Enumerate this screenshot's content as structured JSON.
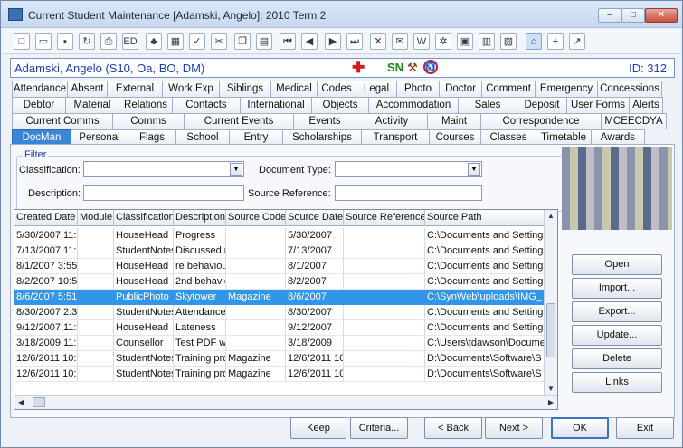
{
  "window": {
    "title": "Current Student Maintenance  [Adamski, Angelo]:  2010 Term 2",
    "min": "–",
    "max": "□",
    "close": "✕"
  },
  "toolbar": {
    "icons": [
      {
        "name": "new-icon",
        "g": "□"
      },
      {
        "name": "open-folder-icon",
        "g": "▭"
      },
      {
        "name": "save-icon",
        "g": "▪"
      },
      {
        "name": "refresh-icon",
        "g": "↻"
      },
      {
        "name": "print-icon",
        "g": "⎙"
      },
      {
        "name": "edit-icon",
        "g": "ED"
      },
      {
        "name": "tree-icon",
        "g": "♣"
      },
      {
        "name": "calculator-icon",
        "g": "▦"
      },
      {
        "name": "spellcheck-icon",
        "g": "✓"
      },
      {
        "name": "cut-icon",
        "g": "✂"
      },
      {
        "name": "copy-icon",
        "g": "❐"
      },
      {
        "name": "paste-icon",
        "g": "▤"
      },
      {
        "name": "first-record-icon",
        "g": "⏮"
      },
      {
        "name": "previous-record-icon",
        "g": "◀"
      },
      {
        "name": "next-record-icon",
        "g": "▶"
      },
      {
        "name": "last-record-icon",
        "g": "⏭"
      },
      {
        "name": "delete-icon",
        "g": "✕"
      },
      {
        "name": "mail-icon",
        "g": "✉"
      },
      {
        "name": "word-icon",
        "g": "W"
      },
      {
        "name": "network-icon",
        "g": "✲"
      },
      {
        "name": "clipboard-icon",
        "g": "▣"
      },
      {
        "name": "barcode-icon",
        "g": "▥"
      },
      {
        "name": "certificate-icon",
        "g": "▧"
      },
      {
        "name": "tag-icon",
        "g": "⌂"
      },
      {
        "name": "add-document-icon",
        "g": "+"
      },
      {
        "name": "arrow-up-right-icon",
        "g": "↗"
      }
    ]
  },
  "student": {
    "name": "Adamski, Angelo (S10, Oa, BO, DM)",
    "sn_label": "SN",
    "id_label": "ID: 312"
  },
  "tabs": {
    "row1": [
      "Attendance",
      "Absent",
      "External",
      "Work Exp",
      "Siblings",
      "Medical",
      "Codes",
      "Legal",
      "Photo",
      "Doctor",
      "Comment",
      "Emergency",
      "Concessions"
    ],
    "row2": [
      "Debtor",
      "Material",
      "Relations",
      "Contacts",
      "International",
      "Objects",
      "Accommodation",
      "Sales",
      "Deposit",
      "User Forms",
      "Alerts"
    ],
    "row3": [
      "Current Comms",
      "Comms",
      "Current Events",
      "Events",
      "Activity",
      "Maint",
      "Correspondence",
      "MCEECDYA"
    ],
    "row4": [
      "DocMan",
      "Personal",
      "Flags",
      "School",
      "Entry",
      "Scholarships",
      "Transport",
      "Courses",
      "Classes",
      "Timetable",
      "Awards"
    ],
    "active": "DocMan"
  },
  "filter": {
    "legend": "Filter",
    "classification_label": "Classification:",
    "classification_value": "",
    "document_type_label": "Document Type:",
    "document_type_value": "",
    "description_label": "Description:",
    "description_value": "",
    "source_reference_label": "Source Reference:",
    "source_reference_value": ""
  },
  "grid": {
    "columns": [
      "Created Date",
      "Module",
      "Classification",
      "Description",
      "Source Code",
      "Source Date",
      "Source Reference",
      "Source Path"
    ],
    "rows": [
      [
        "5/30/2007 11:",
        "",
        "HouseHead",
        "Progress",
        "",
        "5/30/2007",
        "",
        "C:\\Documents and Settings"
      ],
      [
        "7/13/2007 11:",
        "",
        "StudentNotes",
        "Discussed m",
        "",
        "7/13/2007",
        "",
        "C:\\Documents and Settings"
      ],
      [
        "8/1/2007 3:55",
        "",
        "HouseHead",
        "re behaviou",
        "",
        "8/1/2007",
        "",
        "C:\\Documents and Settings"
      ],
      [
        "8/2/2007 10:5",
        "",
        "HouseHead",
        "2nd behavio",
        "",
        "8/2/2007",
        "",
        "C:\\Documents and Settings"
      ],
      [
        "8/6/2007 5:51",
        "",
        "PublicPhoto",
        "Skytower",
        "Magazine",
        "8/6/2007",
        "",
        "C:\\SynWeb\\uploads\\IMG_"
      ],
      [
        "8/30/2007 2:3",
        "",
        "StudentNotes",
        "Attendance",
        "",
        "8/30/2007",
        "",
        "C:\\Documents and Settings"
      ],
      [
        "9/12/2007 11:",
        "",
        "HouseHead",
        "Lateness",
        "",
        "9/12/2007",
        "",
        "C:\\Documents and Settings"
      ],
      [
        "3/18/2009 11:",
        "",
        "Counsellor",
        "Test PDF wi",
        "",
        "3/18/2009",
        "",
        "C:\\Users\\tdawson\\Docume"
      ],
      [
        "12/6/2011 10:",
        "",
        "StudentNotes",
        "Training pro",
        "Magazine",
        "12/6/2011 10",
        "",
        "D:\\Documents\\Software\\S"
      ],
      [
        "12/6/2011 10:",
        "",
        "StudentNotes",
        "Training pro",
        "Magazine",
        "12/6/2011 10",
        "",
        "D:\\Documents\\Software\\S"
      ]
    ],
    "selected_row": 4
  },
  "side_buttons": [
    "Open",
    "Import...",
    "Export...",
    "Update...",
    "Delete",
    "Links"
  ],
  "bottom_buttons": [
    "Keep",
    "Criteria...",
    "< Back",
    "Next >",
    "OK",
    "Exit"
  ]
}
